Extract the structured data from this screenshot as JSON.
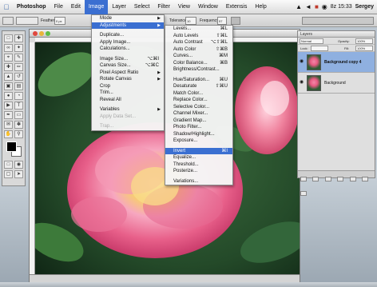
{
  "menubar": {
    "app_name": "Photoshop",
    "items": [
      "File",
      "Edit",
      "Image",
      "Layer",
      "Select",
      "Filter",
      "View",
      "Window",
      "Extensis",
      "Help"
    ],
    "active_item": "Image",
    "clock": "8z 15:33",
    "user": "Sergey"
  },
  "options_bar": {
    "feather_label": "Feather:",
    "feather_value": "0 px",
    "tolerance_label": "Tolerance:",
    "tolerance_value": "10",
    "frequency_label": "Frequency:",
    "frequency_value": "57"
  },
  "image_menu": {
    "items": [
      {
        "label": "Mode",
        "arrow": true
      },
      {
        "label": "Adjustments",
        "arrow": true,
        "selected": true
      },
      {
        "sep": true
      },
      {
        "label": "Duplicate..."
      },
      {
        "label": "Apply Image..."
      },
      {
        "label": "Calculations..."
      },
      {
        "sep": true
      },
      {
        "label": "Image Size...",
        "shortcut": "⌥⌘I"
      },
      {
        "label": "Canvas Size...",
        "shortcut": "⌥⌘C"
      },
      {
        "label": "Pixel Aspect Ratio",
        "arrow": true
      },
      {
        "label": "Rotate Canvas",
        "arrow": true
      },
      {
        "label": "Crop"
      },
      {
        "label": "Trim..."
      },
      {
        "label": "Reveal All"
      },
      {
        "sep": true
      },
      {
        "label": "Variables",
        "arrow": true
      },
      {
        "label": "Apply Data Set...",
        "dim": true
      },
      {
        "sep": true
      },
      {
        "label": "Trap...",
        "dim": true
      }
    ]
  },
  "adjustments_menu": {
    "items": [
      {
        "label": "Levels...",
        "shortcut": "⌘L"
      },
      {
        "label": "Auto Levels",
        "shortcut": "⇧⌘L"
      },
      {
        "label": "Auto Contrast",
        "shortcut": "⌥⇧⌘L"
      },
      {
        "label": "Auto Color",
        "shortcut": "⇧⌘B"
      },
      {
        "label": "Curves...",
        "shortcut": "⌘M"
      },
      {
        "label": "Color Balance...",
        "shortcut": "⌘B"
      },
      {
        "label": "Brightness/Contrast..."
      },
      {
        "sep": true
      },
      {
        "label": "Hue/Saturation...",
        "shortcut": "⌘U"
      },
      {
        "label": "Desaturate",
        "shortcut": "⇧⌘U"
      },
      {
        "label": "Match Color..."
      },
      {
        "label": "Replace Color..."
      },
      {
        "label": "Selective Color..."
      },
      {
        "label": "Channel Mixer..."
      },
      {
        "label": "Gradient Map..."
      },
      {
        "label": "Photo Filter..."
      },
      {
        "label": "Shadow/Highlight..."
      },
      {
        "label": "Exposure..."
      },
      {
        "sep": true
      },
      {
        "label": "Invert",
        "shortcut": "⌘I",
        "selected": true
      },
      {
        "label": "Equalize..."
      },
      {
        "label": "Threshold..."
      },
      {
        "label": "Posterize..."
      },
      {
        "sep": true
      },
      {
        "label": "Variations..."
      }
    ]
  },
  "layers_palette": {
    "tab": "Layers",
    "blend_mode": "Normal",
    "opacity_label": "Opacity:",
    "opacity_value": "100%",
    "fill_label": "Fill:",
    "fill_value": "100%",
    "lock_label": "Lock:",
    "layers": [
      {
        "name": "Background copy 4",
        "selected": true
      },
      {
        "name": "Background",
        "selected": false
      }
    ]
  },
  "colors": {
    "menu_highlight": "#3b6fd1",
    "rose_pink": "#e8608a",
    "leaf_green": "#2f5e35"
  }
}
